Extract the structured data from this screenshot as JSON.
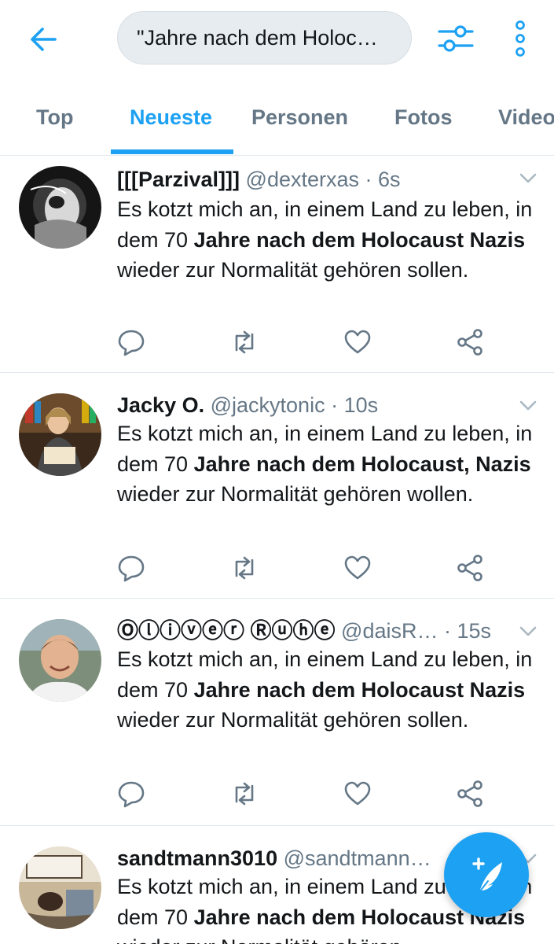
{
  "header": {
    "search_query": "\"Jahre nach dem Holoc…",
    "back_icon": "arrow-left-icon",
    "filter_icon": "sliders-icon",
    "more_icon": "more-vertical-icon"
  },
  "tabs": [
    {
      "label": "Top"
    },
    {
      "label": "Neueste"
    },
    {
      "label": "Personen"
    },
    {
      "label": "Fotos"
    },
    {
      "label": "Video"
    }
  ],
  "tweets": [
    {
      "name": "[[[Parzival]]]",
      "handle": "@dexterxas",
      "time": "· 6s",
      "text_pre": "Es kotzt mich an, in einem Land zu leben, in dem 70 ",
      "text_bold": "Jahre nach dem Holocaust Nazis",
      "text_post": " wieder zur Normalität gehören sollen."
    },
    {
      "name": "Jacky O.",
      "handle": "@jackytonic",
      "time": "· 10s",
      "text_pre": "Es kotzt mich an, in einem Land zu leben, in dem 70 ",
      "text_bold": "Jahre nach dem Holocaust, Nazis",
      "text_post": " wieder zur Normalität gehören wollen."
    },
    {
      "name": "Ⓞⓛⓘⓥⓔⓡ Ⓡⓤⓗⓔ",
      "handle": "@daisR…",
      "time": "· 15s",
      "text_pre": "Es kotzt mich an, in einem Land zu leben, in dem 70 ",
      "text_bold": "Jahre nach dem Holocaust Nazis",
      "text_post": " wieder zur Normalität gehören sollen."
    },
    {
      "name": "sandtmann3010",
      "handle": "@sandtmann…",
      "time": "",
      "text_pre": "Es kotzt mich an, in einem Land zu leben, in dem 70 ",
      "text_bold": "Jahre nach dem Holocaust Nazis",
      "text_post": " wieder zur Normalität gehören"
    }
  ],
  "colors": {
    "accent": "#1da1f2",
    "secondary_text": "#657786",
    "divider": "#e1e8ed"
  }
}
